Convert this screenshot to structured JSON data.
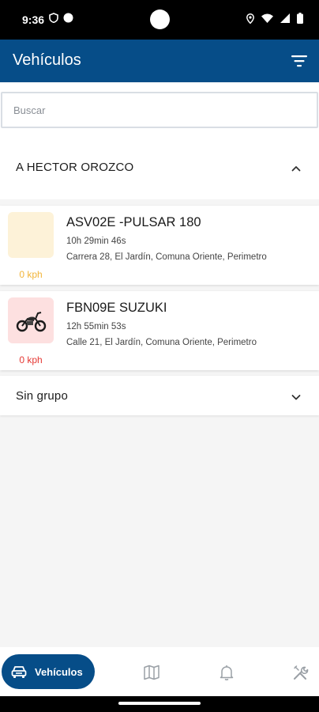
{
  "status_bar": {
    "time": "9:36"
  },
  "app_bar": {
    "title": "Vehículos"
  },
  "search": {
    "placeholder": "Buscar"
  },
  "groups": [
    {
      "name": "A HECTOR OROZCO",
      "expanded": true,
      "vehicles": [
        {
          "name": "ASV02E -PULSAR 180",
          "duration": "10h 29min 46s",
          "address": "Carrera 28, El Jardín, Comuna Oriente, Perimetro",
          "speed": "0 kph",
          "status_color": "#f2b53a",
          "thumb_bg": "#fdf2d8",
          "has_icon": false
        },
        {
          "name": "FBN09E SUZUKI",
          "duration": "12h 55min 53s",
          "address": "Calle 21, El Jardín, Comuna Oriente, Perimetro",
          "speed": "0 kph",
          "status_color": "#e53935",
          "thumb_bg": "#fde0e0",
          "has_icon": true,
          "icon": "motorcycle-icon"
        }
      ]
    },
    {
      "name": "Sin grupo",
      "expanded": false
    }
  ],
  "bottom_nav": {
    "active_label": "Vehículos",
    "items": [
      "car-icon",
      "map-icon",
      "bell-icon",
      "tools-icon"
    ]
  },
  "colors": {
    "primary": "#064d88",
    "background": "#f5f5f5"
  }
}
